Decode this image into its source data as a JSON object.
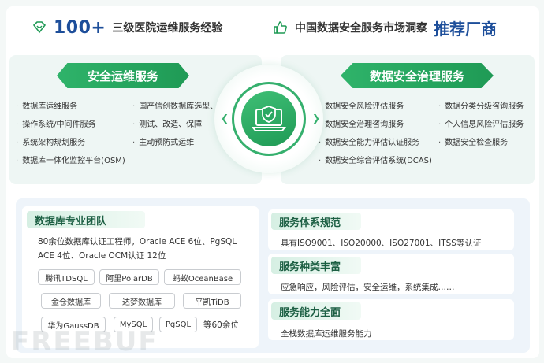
{
  "header": {
    "left": {
      "number": "100+",
      "text": "三级医院运维服务经验",
      "icon": "diamond-heart-icon"
    },
    "right": {
      "text": "中国数据安全服务市场洞察",
      "highlight": "推荐厂商",
      "icon": "thumbs-up-icon"
    }
  },
  "ops_service": {
    "title": "安全运维服务",
    "col1": [
      "数据库运维服务",
      "操作系统/中间件服务",
      "系统架构规划服务",
      "数据库一体化监控平台(OSM)"
    ],
    "col2": [
      "国产信创数据库选型、",
      "测试、改造、保障",
      "主动预防式运维"
    ]
  },
  "governance_service": {
    "title": "数据安全治理服务",
    "col1": [
      "数据安全风险评估服务",
      "数据安全治理咨询服务",
      "数据安全能力评估认证服务",
      "数据安全综合评估系统(DCAS)"
    ],
    "col2": [
      "数据分类分级咨询服务",
      "个人信息风险评估服务",
      "数据安全检查服务"
    ]
  },
  "center": {
    "icon": "shield-laptop-icon"
  },
  "team": {
    "title": "数据库专业团队",
    "desc": "80余位数据库认证工程师，Oracle ACE 6位、PgSQL ACE 4位、Oracle OCM认证 12位",
    "tags": [
      "腾讯TDSQL",
      "阿里PolarDB",
      "蚂蚁OceanBase",
      "金仓数据库",
      "达梦数据库",
      "平凯TiDB",
      "华为GaussDB",
      "MySQL",
      "PgSQL"
    ],
    "etc": "等60余位"
  },
  "cards": [
    {
      "title": "服务体系规范",
      "desc": "具有ISO9001、ISO20000、ISO27001、ITSS等认证"
    },
    {
      "title": "服务种类丰富",
      "desc": "应急响应，风险评估，安全运维，系统集成……"
    },
    {
      "title": "服务能力全面",
      "desc": "全栈数据库运维服务能力"
    }
  ],
  "watermark": "FREEBUF",
  "colors": {
    "brand_green": "#1f9a55",
    "brand_blue": "#1d4e9a",
    "panel_bg": "#eef6f4"
  }
}
